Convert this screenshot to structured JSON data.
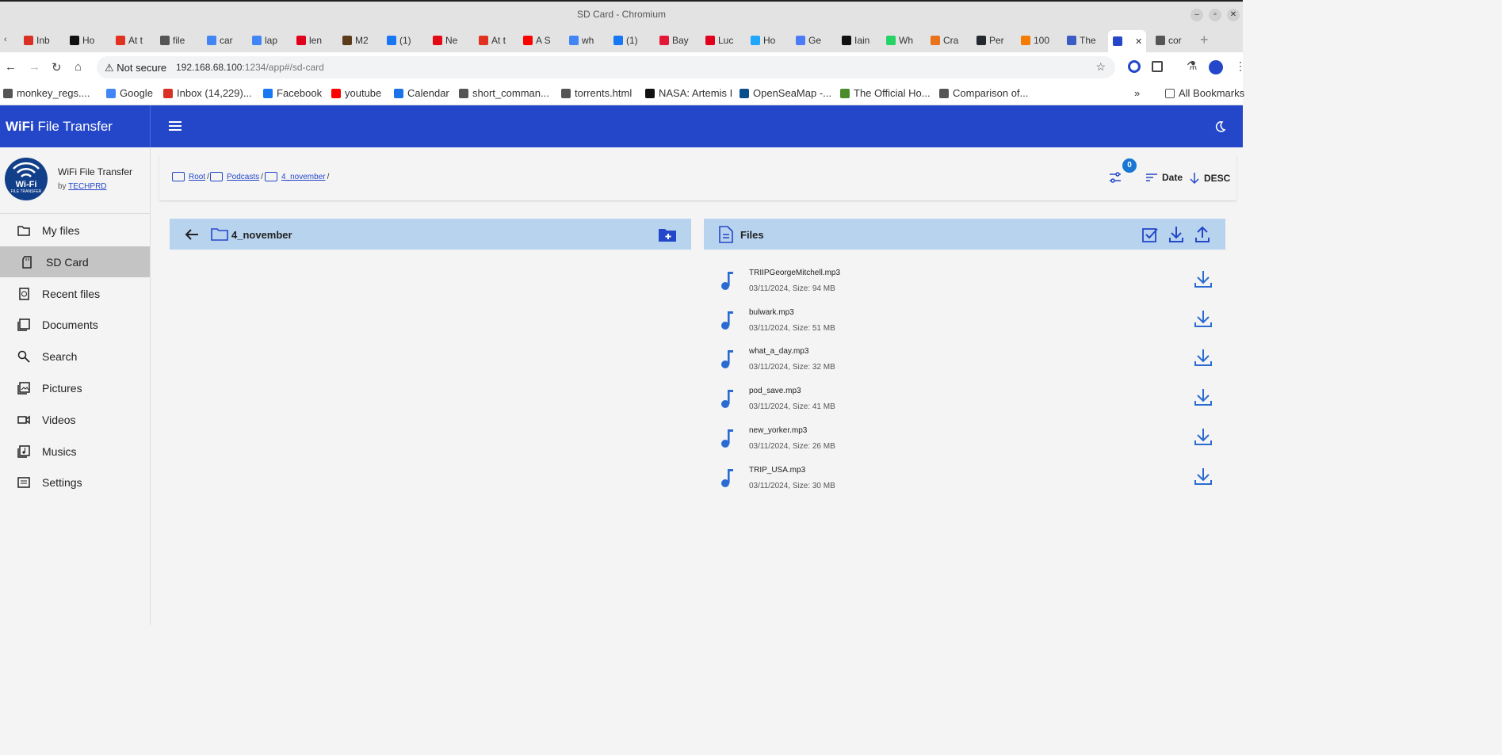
{
  "window": {
    "title": "SD Card - Chromium"
  },
  "tabs": [
    {
      "label": "Inb",
      "color": "#d93025"
    },
    {
      "label": "Ho",
      "color": "#111"
    },
    {
      "label": "At t",
      "color": "#e0331f"
    },
    {
      "label": "file",
      "color": "#555"
    },
    {
      "label": "car",
      "color": "#4285f4"
    },
    {
      "label": "lap",
      "color": "#4285f4"
    },
    {
      "label": "len",
      "color": "#e0001b"
    },
    {
      "label": "M2",
      "color": "#5b3c1b"
    },
    {
      "label": "(1)",
      "color": "#1877f2"
    },
    {
      "label": "Ne",
      "color": "#e50914"
    },
    {
      "label": "At t",
      "color": "#e0331f"
    },
    {
      "label": "A S",
      "color": "#ff0000"
    },
    {
      "label": "wh",
      "color": "#4285f4"
    },
    {
      "label": "(1)",
      "color": "#1877f2"
    },
    {
      "label": "Bay",
      "color": "#e31837"
    },
    {
      "label": "Luc",
      "color": "#e0001b"
    },
    {
      "label": "Ho",
      "color": "#1ea7fd"
    },
    {
      "label": "Ge",
      "color": "#4e7cf6"
    },
    {
      "label": "Iain",
      "color": "#111"
    },
    {
      "label": "Wh",
      "color": "#25d366"
    },
    {
      "label": "Cra",
      "color": "#e8731a"
    },
    {
      "label": "Per",
      "color": "#24292f"
    },
    {
      "label": "100",
      "color": "#f57c00"
    },
    {
      "label": "The",
      "color": "#3b5cc4"
    },
    {
      "label": "",
      "color": "#2447c9"
    },
    {
      "label": "cor",
      "color": "#555"
    }
  ],
  "address": {
    "security": "Not secure",
    "host": "192.168.68.100",
    "rest": ":1234/app#/sd-card"
  },
  "bookmarks": [
    {
      "label": "monkey_regs....",
      "color": "#555"
    },
    {
      "label": "Google",
      "color": "#4285f4"
    },
    {
      "label": "Inbox (14,229)...",
      "color": "#d93025"
    },
    {
      "label": "Facebook",
      "color": "#1877f2"
    },
    {
      "label": "youtube",
      "color": "#ff0000"
    },
    {
      "label": "Calendar",
      "color": "#1a73e8"
    },
    {
      "label": "short_comman...",
      "color": "#555"
    },
    {
      "label": "torrents.html",
      "color": "#555"
    },
    {
      "label": "NASA: Artemis I",
      "color": "#111"
    },
    {
      "label": "OpenSeaMap -...",
      "color": "#0a4d8c"
    },
    {
      "label": "The Official Ho...",
      "color": "#4a8c2a"
    },
    {
      "label": "Comparison of...",
      "color": "#555"
    }
  ],
  "bookmarks_more": "»",
  "all_bookmarks": "All Bookmarks",
  "app": {
    "brand_bold": "WiFi",
    "brand_rest": " File Transfer",
    "accent": "#2447c9"
  },
  "profile": {
    "name": "WiFi File Transfer",
    "by": "by ",
    "author": "TECHPRD",
    "logo_text": "Wi-Fi",
    "logo_sub": "FILE TRANSFER"
  },
  "menu": [
    {
      "label": "My files",
      "icon": "folder-open-icon"
    },
    {
      "label": "SD Card",
      "icon": "sd-card-icon",
      "active": true
    },
    {
      "label": "Recent files",
      "icon": "recent-icon"
    },
    {
      "label": "Documents",
      "icon": "pdf-icon"
    },
    {
      "label": "Search",
      "icon": "search-icon"
    },
    {
      "label": "Pictures",
      "icon": "pictures-icon"
    },
    {
      "label": "Videos",
      "icon": "video-icon"
    },
    {
      "label": "Musics",
      "icon": "music-library-icon"
    },
    {
      "label": "Settings",
      "icon": "settings-icon"
    }
  ],
  "breadcrumb": [
    {
      "label": "Root"
    },
    {
      "label": "Podcasts"
    },
    {
      "label": "4_november"
    }
  ],
  "breadcrumb_sep": "/",
  "filter_count": "0",
  "sort": {
    "field": "Date",
    "order": "DESC"
  },
  "folders_panel": {
    "title": "4_november"
  },
  "files_panel": {
    "title": "Files"
  },
  "files": [
    {
      "name": "TRIIPGeorgeMitchell.mp3",
      "meta": "03/11/2024, Size: 94 MB"
    },
    {
      "name": "bulwark.mp3",
      "meta": "03/11/2024, Size: 51 MB"
    },
    {
      "name": "what_a_day.mp3",
      "meta": "03/11/2024, Size: 32 MB"
    },
    {
      "name": "pod_save.mp3",
      "meta": "03/11/2024, Size: 41 MB"
    },
    {
      "name": "new_yorker.mp3",
      "meta": "03/11/2024, Size: 26 MB"
    },
    {
      "name": "TRIP_USA.mp3",
      "meta": "03/11/2024, Size: 30 MB"
    }
  ]
}
